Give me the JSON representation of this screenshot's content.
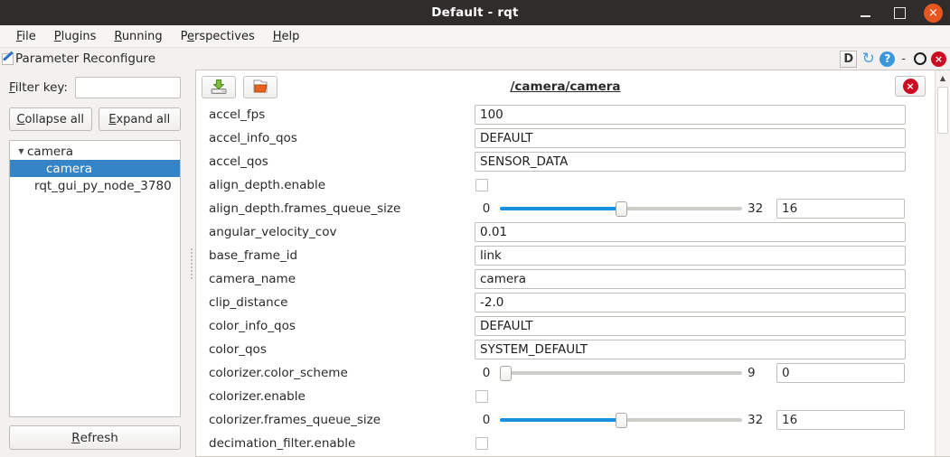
{
  "window": {
    "title": "Default - rqt",
    "minimize_label": "minimize",
    "maximize_label": "maximize",
    "close_label": "×"
  },
  "menubar": {
    "items": [
      {
        "label": "File",
        "mnemonic": "F"
      },
      {
        "label": "Plugins",
        "mnemonic": "P"
      },
      {
        "label": "Running",
        "mnemonic": "R"
      },
      {
        "label": "Perspectives",
        "mnemonic": "e"
      },
      {
        "label": "Help",
        "mnemonic": "H"
      }
    ]
  },
  "dock": {
    "title": "Parameter Reconfigure",
    "actions": {
      "d_label": "D",
      "reload_glyph": "↻",
      "help_label": "?",
      "minimize_glyph": "-",
      "float_label": "float",
      "close_glyph": "×"
    }
  },
  "sidebar": {
    "filter_label": "Filter key:",
    "filter_value": "",
    "filter_placeholder": "",
    "collapse_label": "Collapse all",
    "expand_label": "Expand all",
    "refresh_label": "Refresh",
    "tree": [
      {
        "label": "camera",
        "level": 0,
        "expanded": true,
        "selected": false,
        "arrow": "▼"
      },
      {
        "label": "camera",
        "level": 1,
        "expanded": false,
        "selected": true,
        "arrow": ""
      },
      {
        "label": "rqt_gui_py_node_3780",
        "level": 1,
        "expanded": false,
        "selected": false,
        "arrow": ""
      }
    ]
  },
  "panel": {
    "node_name": "/camera/camera",
    "save_button_tooltip": "Save",
    "load_button_tooltip": "Load",
    "close_button_glyph": "×",
    "accent_color": "#1a8fe0",
    "selection_color": "#3584c6",
    "params": [
      {
        "name": "accel_fps",
        "type": "text",
        "value": "100"
      },
      {
        "name": "accel_info_qos",
        "type": "text",
        "value": "DEFAULT"
      },
      {
        "name": "accel_qos",
        "type": "text",
        "value": "SENSOR_DATA"
      },
      {
        "name": "align_depth.enable",
        "type": "checkbox",
        "checked": false
      },
      {
        "name": "align_depth.frames_queue_size",
        "type": "slider",
        "min": "0",
        "max": "32",
        "value": "16",
        "pct": 50
      },
      {
        "name": "angular_velocity_cov",
        "type": "text",
        "value": "0.01"
      },
      {
        "name": "base_frame_id",
        "type": "text",
        "value": "link"
      },
      {
        "name": "camera_name",
        "type": "text",
        "value": "camera"
      },
      {
        "name": "clip_distance",
        "type": "text",
        "value": "-2.0"
      },
      {
        "name": "color_info_qos",
        "type": "text",
        "value": "DEFAULT"
      },
      {
        "name": "color_qos",
        "type": "text",
        "value": "SYSTEM_DEFAULT"
      },
      {
        "name": "colorizer.color_scheme",
        "type": "slider",
        "min": "0",
        "max": "9",
        "value": "0",
        "pct": 0
      },
      {
        "name": "colorizer.enable",
        "type": "checkbox",
        "checked": false
      },
      {
        "name": "colorizer.frames_queue_size",
        "type": "slider",
        "min": "0",
        "max": "32",
        "value": "16",
        "pct": 50
      },
      {
        "name": "decimation_filter.enable",
        "type": "checkbox",
        "checked": false
      }
    ]
  },
  "scrollbar": {
    "up_glyph": "▲"
  }
}
